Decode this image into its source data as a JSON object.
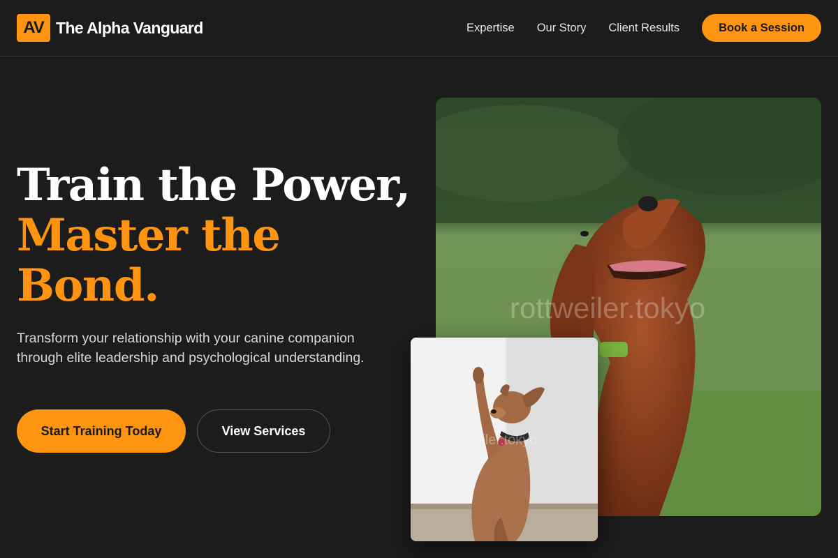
{
  "brand": {
    "mark": "AV",
    "name": "The Alpha Vanguard",
    "accent_color": "#ff9410",
    "background_color": "#1c1c1c"
  },
  "nav": {
    "links": [
      "Expertise",
      "Our Story",
      "Client Results"
    ],
    "cta": "Book a Session"
  },
  "hero": {
    "title_line1": "Train the Power,",
    "title_accent": "Master the Bond.",
    "subtitle": "Transform your relationship with your canine companion through elite leadership and psychological understanding.",
    "primary_button": "Start Training Today",
    "secondary_button": "View Services"
  },
  "images": {
    "main_watermark": "rottweiler.tokyo",
    "small_watermark": "rottweiler.tokyo"
  }
}
